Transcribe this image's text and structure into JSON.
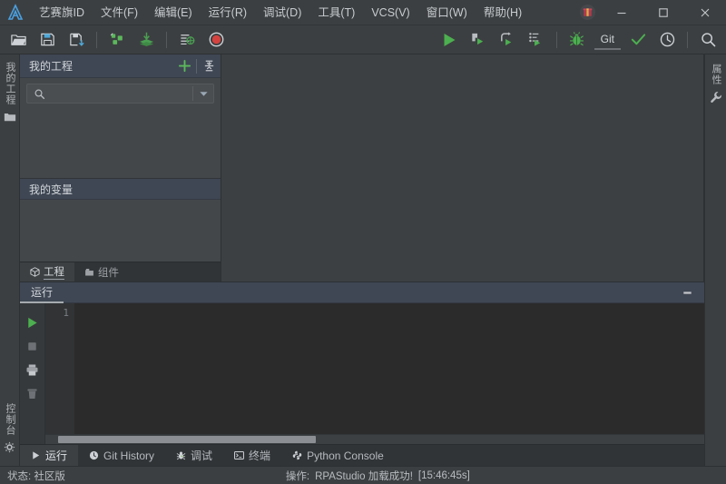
{
  "app": {
    "accent_green": "#4a9e52",
    "panel_header_blue": "#3f4754",
    "bg_dark": "#3c4043",
    "console_bg": "#2b2b2b"
  },
  "titlebar": {
    "logo_name": "app-logo",
    "menus": [
      {
        "label": "艺赛旗ID",
        "name": "menu-isearch-id"
      },
      {
        "label": "文件(F)",
        "name": "menu-file"
      },
      {
        "label": "编辑(E)",
        "name": "menu-edit"
      },
      {
        "label": "运行(R)",
        "name": "menu-run"
      },
      {
        "label": "调试(D)",
        "name": "menu-debug"
      },
      {
        "label": "工具(T)",
        "name": "menu-tools"
      },
      {
        "label": "VCS(V)",
        "name": "menu-vcs"
      },
      {
        "label": "窗口(W)",
        "name": "menu-window"
      },
      {
        "label": "帮助(H)",
        "name": "menu-help"
      }
    ],
    "gift_title": "gift",
    "minimize": "—",
    "maximize": "□",
    "close": "✕"
  },
  "toolbar": {
    "buttons": [
      {
        "name": "open-project-icon",
        "title": "打开"
      },
      {
        "name": "save-icon",
        "title": "保存"
      },
      {
        "name": "save-as-icon",
        "title": "另存为"
      },
      {
        "name": "components-icon",
        "title": "组件"
      },
      {
        "name": "install-package-icon",
        "title": "安装"
      },
      {
        "name": "settings-list-icon",
        "title": "配置"
      },
      {
        "name": "record-icon",
        "title": "录制"
      },
      {
        "name": "run-icon",
        "title": "运行"
      },
      {
        "name": "step-into-icon",
        "title": "步入"
      },
      {
        "name": "step-over-icon",
        "title": "步过"
      },
      {
        "name": "step-out-icon",
        "title": "步出"
      },
      {
        "name": "debug-icon",
        "title": "调试"
      },
      {
        "name": "check-icon",
        "title": "校验"
      },
      {
        "name": "history-icon",
        "title": "历史"
      },
      {
        "name": "search-icon",
        "title": "搜索"
      }
    ],
    "git_label": "Git"
  },
  "left_rail": {
    "project_label": "我的工程",
    "console_label": "控制台"
  },
  "right_rail": {
    "properties_label": "属性"
  },
  "project_dock": {
    "title": "我的工程",
    "add_label": "+",
    "collapse_title": "collapse-all",
    "search_placeholder": "",
    "search_value": "",
    "tree_items": [],
    "variables_title": "我的变量",
    "variable_items": [],
    "tabs": [
      {
        "label": "工程",
        "name": "dock-tab-project",
        "active": true,
        "icon": "cube-icon"
      },
      {
        "label": "组件",
        "name": "dock-tab-components",
        "active": false,
        "icon": "package-icon"
      }
    ]
  },
  "run_panel": {
    "tab_label": "运行",
    "minimize_label": "—",
    "rail_buttons": [
      {
        "name": "console-run-icon",
        "title": "运行"
      },
      {
        "name": "console-stop-icon",
        "title": "停止"
      },
      {
        "name": "console-print-icon",
        "title": "打印"
      },
      {
        "name": "console-clear-icon",
        "title": "清空"
      }
    ],
    "line_numbers": "1",
    "console_output": ""
  },
  "bottom_tabs": [
    {
      "label": "运行",
      "name": "bottom-tab-run",
      "active": true,
      "icon": "play-icon"
    },
    {
      "label": "Git History",
      "name": "bottom-tab-git-history",
      "active": false,
      "icon": "clock-icon"
    },
    {
      "label": "调试",
      "name": "bottom-tab-debug",
      "active": false,
      "icon": "bug-icon"
    },
    {
      "label": "终端",
      "name": "bottom-tab-terminal",
      "active": false,
      "icon": "terminal-icon"
    },
    {
      "label": "Python Console",
      "name": "bottom-tab-python-console",
      "active": false,
      "icon": "python-icon"
    }
  ],
  "statusbar": {
    "status_text": "状态: 社区版",
    "operation_label": "操作:",
    "operation_text": "RPAStudio 加载成功!",
    "timestamp": "[15:46:45s]"
  }
}
